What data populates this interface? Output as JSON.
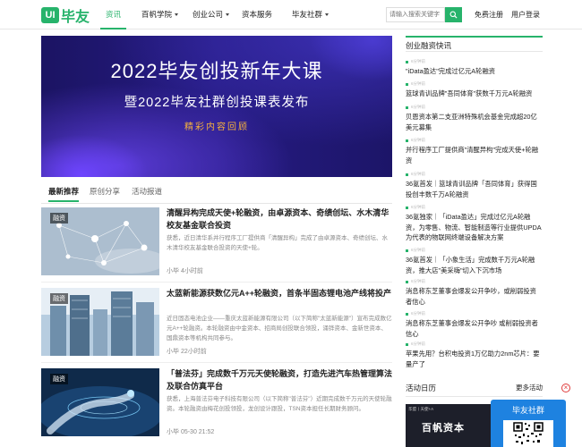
{
  "nav": {
    "logo_box": "UI",
    "logo_text": "毕友",
    "items": [
      {
        "label": "资讯",
        "active": true,
        "dropdown": false
      },
      {
        "label": "百帆学院",
        "active": false,
        "dropdown": true
      },
      {
        "label": "创业公司",
        "active": false,
        "dropdown": true
      },
      {
        "label": "资本服务",
        "active": false,
        "dropdown": false
      },
      {
        "label": "毕友社群",
        "active": false,
        "dropdown": true
      }
    ],
    "search_placeholder": "请输入搜索关键字",
    "search_icon": "search-icon",
    "register": "免费注册",
    "login": "用户登录"
  },
  "banner": {
    "title": "2022毕友创投新年大课",
    "subtitle": "暨2022毕友社群创投课表发布",
    "tag": "精彩内容回顾"
  },
  "tabs": [
    {
      "label": "最新推荐",
      "active": true
    },
    {
      "label": "原创分享",
      "active": false
    },
    {
      "label": "活动报道",
      "active": false
    }
  ],
  "articles": [
    {
      "thumb_label": "融资",
      "title": "清醒异构完成天使+轮融资，由卓源资本、奇绩创坛、水木清华校友基金联合投资",
      "desc": "获悉，近日清华系并行程序工厂提供商「清醒异构」完成了由卓源资本、奇绩创坛、水木清华校友基金联合投资的天使+轮。",
      "meta": "小毕 4小时前"
    },
    {
      "thumb_label": "融资",
      "title": "太蓝新能源获数亿元A++轮融资，首条半固态锂电池产线将投产",
      "desc": "近日固态电池企业——重庆太蓝新能源有限公司（以下简称\"太蓝新能源\"）宣布完成数亿元A++轮融资。本轮融资由中金资本、招商局创投联合领投，涌铧资本、金新世资本、国鼎资本等机构共同参与。",
      "meta": "小毕 22小时前"
    },
    {
      "thumb_label": "融资",
      "title": "「普法芬」完成数千万元天使轮融资，打造先进汽车热管理算法及联合仿真平台",
      "desc": "获悉，上海普法芬电子科技有限公司（以下简称\"普法芬\"）近期完成数千万元的天使轮融资。本轮融资由梅花创投领投，龙创设计跟投，TSN资本担任长期财务顾问。",
      "meta": "小毕 05-30 21:52"
    }
  ],
  "sidebar": {
    "title": "创业融资快讯",
    "news": [
      {
        "time": "6分钟前",
        "text": "\"iData盈达\"完成过亿元A轮融资"
      },
      {
        "time": "6分钟前",
        "text": "篮球青训品牌\"吾同体育\"获数千万元A轮融资"
      },
      {
        "time": "6分钟前",
        "text": "贝恩资本第二支亚洲特殊机会基金完成超20亿美元募集"
      },
      {
        "time": "6分钟前",
        "text": "并行程序工厂提供商\"清醒异构\"完成天使+轮融资"
      },
      {
        "time": "6分钟前",
        "text": "36氪首发｜篮球青训品牌「吾同体育」获得国投创丰数千万A轮融资"
      },
      {
        "time": "6分钟前",
        "text": "36氪独家｜「iData盈达」完成过亿元A轮融资，为零售、物流、智能制造等行业提供UPDA为代表的物联网终端设备解决方案"
      },
      {
        "time": "6分钟前",
        "text": "36氪首发｜「小象生活」完成数千万元A轮融资，推大店\"美采嗨\"切入下沉市场"
      },
      {
        "time": "6分钟前",
        "text": "消息称东芝董事会爆发公开争吵，或削弱投资者信心"
      },
      {
        "time": "6分钟前",
        "text": "消息称东芝董事会爆发公开争吵 或削弱投资者信心"
      },
      {
        "time": "6分钟前",
        "text": "苹果先用？台积电投资1万亿助力2nm芯片：要量产了"
      }
    ],
    "calendar_title": "活动日历",
    "calendar_more": "更多活动",
    "calendar_thumb_top": "华盟丨天使+A",
    "calendar_thumb_text": "百帆资本"
  },
  "floating": {
    "title": "毕友社群",
    "close": "×"
  },
  "colors": {
    "accent": "#27b36b",
    "banner_bg": "#221a7a",
    "banner_tag": "#f5b13d",
    "float_blue": "#1e82e0"
  }
}
